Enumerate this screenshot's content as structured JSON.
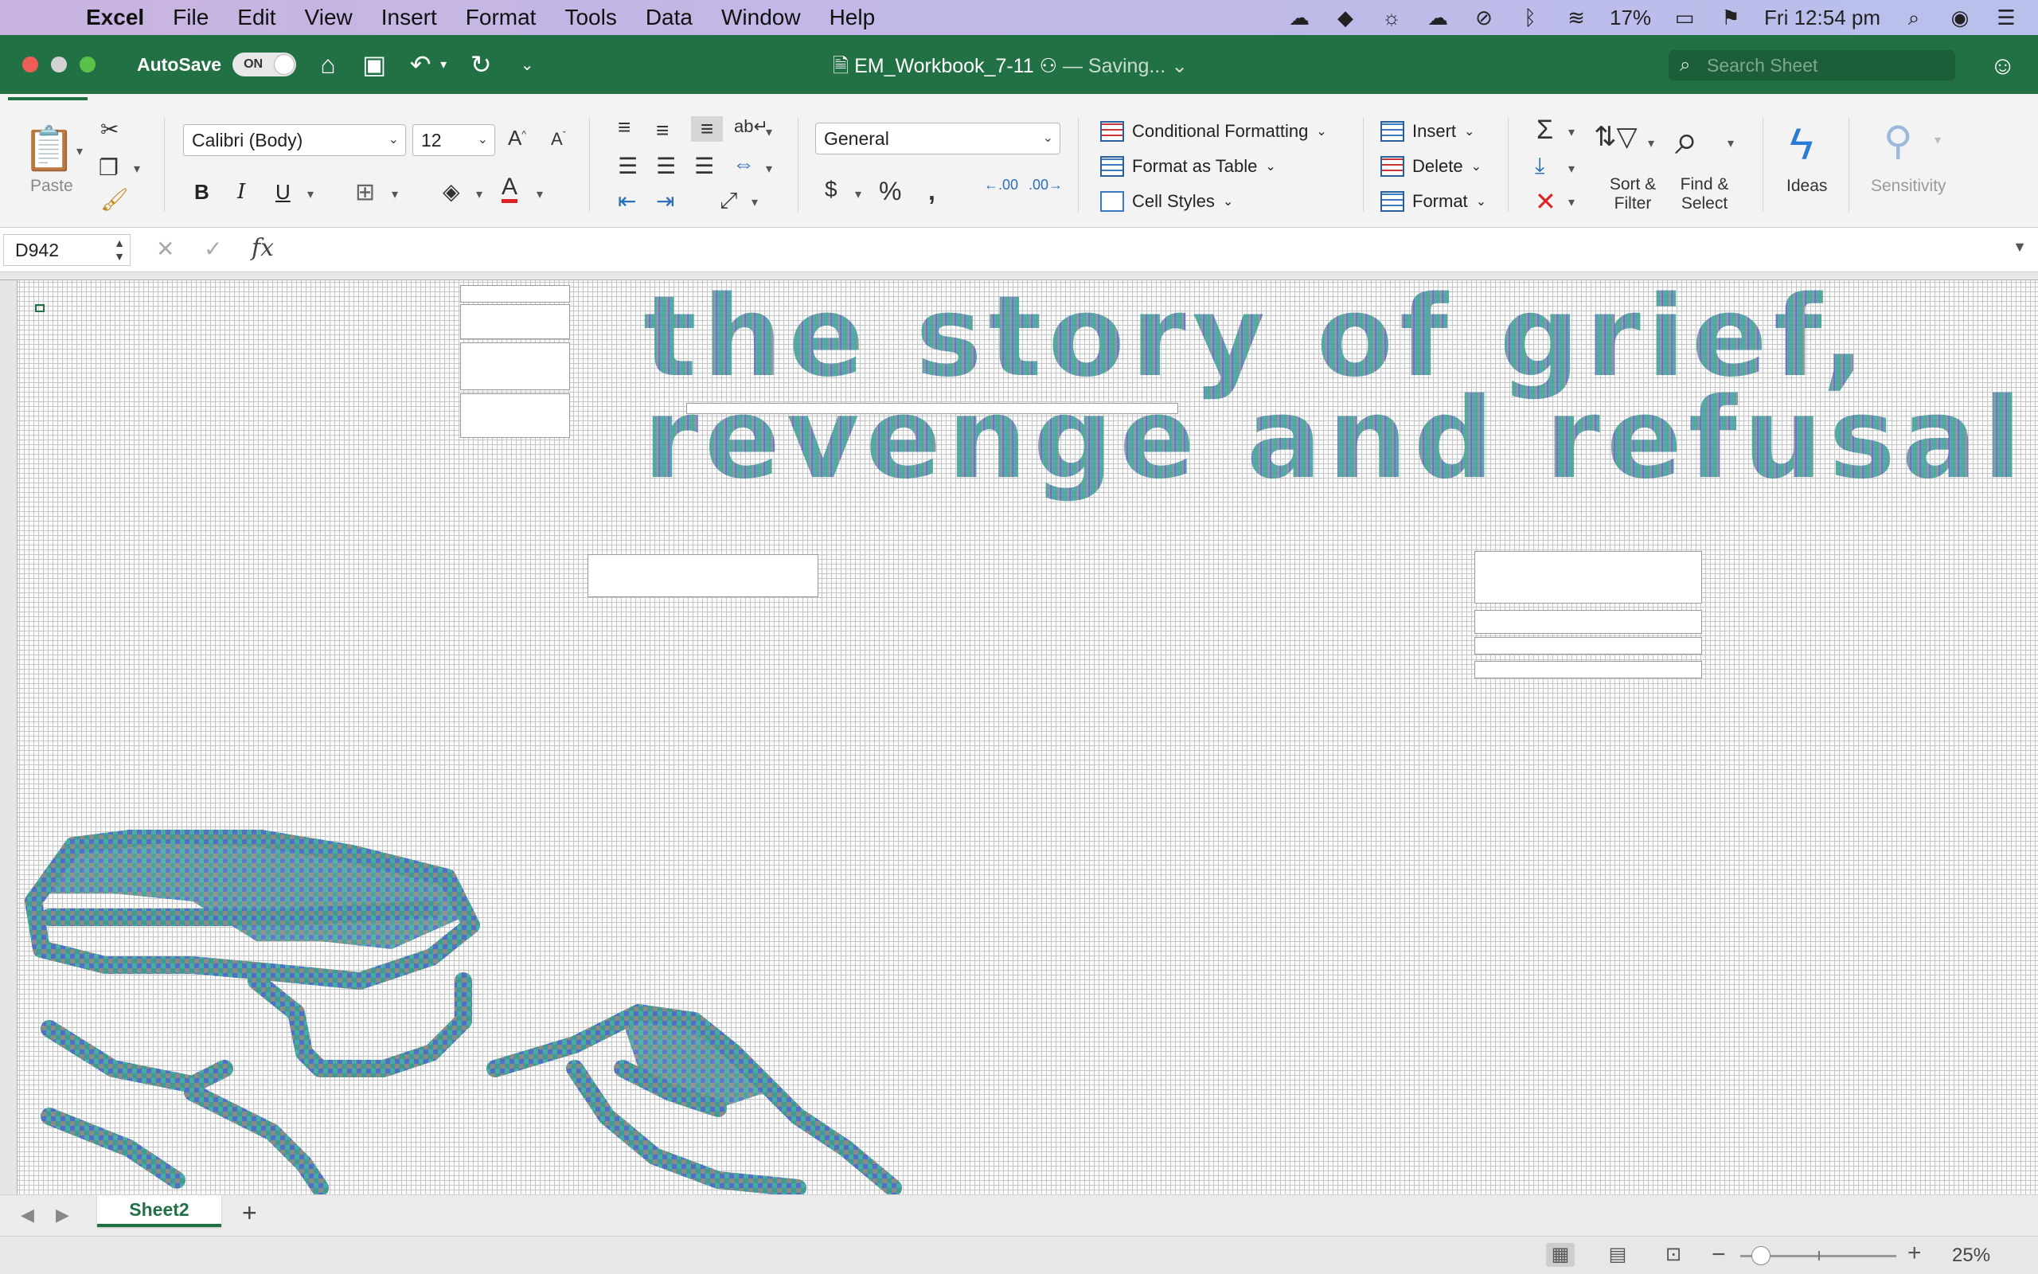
{
  "menubar": {
    "app": "Excel",
    "items": [
      "File",
      "Edit",
      "View",
      "Insert",
      "Format",
      "Tools",
      "Data",
      "Window",
      "Help"
    ],
    "battery": "17%",
    "clock": "Fri 12:54 pm"
  },
  "titlebar": {
    "autosave_label": "AutoSave",
    "autosave_state": "ON",
    "doc_name": "EM_Workbook_7-11",
    "status": "— Saving...",
    "search_placeholder": "Search Sheet"
  },
  "ribbon": {
    "paste_label": "Paste",
    "font_name": "Calibri (Body)",
    "font_size": "12",
    "bold": "B",
    "italic": "I",
    "underline": "U",
    "number_format": "General",
    "conditional_formatting": "Conditional Formatting",
    "format_as_table": "Format as Table",
    "cell_styles": "Cell Styles",
    "insert": "Insert",
    "delete": "Delete",
    "format": "Format",
    "sort_filter_1": "Sort &",
    "sort_filter_2": "Filter",
    "find_select_1": "Find &",
    "find_select_2": "Select",
    "ideas": "Ideas",
    "sensitivity": "Sensitivity",
    "dec_inc": ".00",
    "dec_dec": ".00"
  },
  "formulabar": {
    "name_box": "D942",
    "fx": "fx",
    "value": ""
  },
  "sheet": {
    "title_line1": "the story of grief,",
    "title_line2": "revenge and refusal"
  },
  "tabs": {
    "sheets": [
      "Sheet2"
    ]
  },
  "statusbar": {
    "zoom": "25%",
    "zoom_fraction": 0.25
  },
  "colors": {
    "excel_green": "#227144",
    "pixel_teal": "#3c9c95",
    "pixel_grey": "#8a8a8a",
    "pixel_purple": "#5a5ed8"
  }
}
